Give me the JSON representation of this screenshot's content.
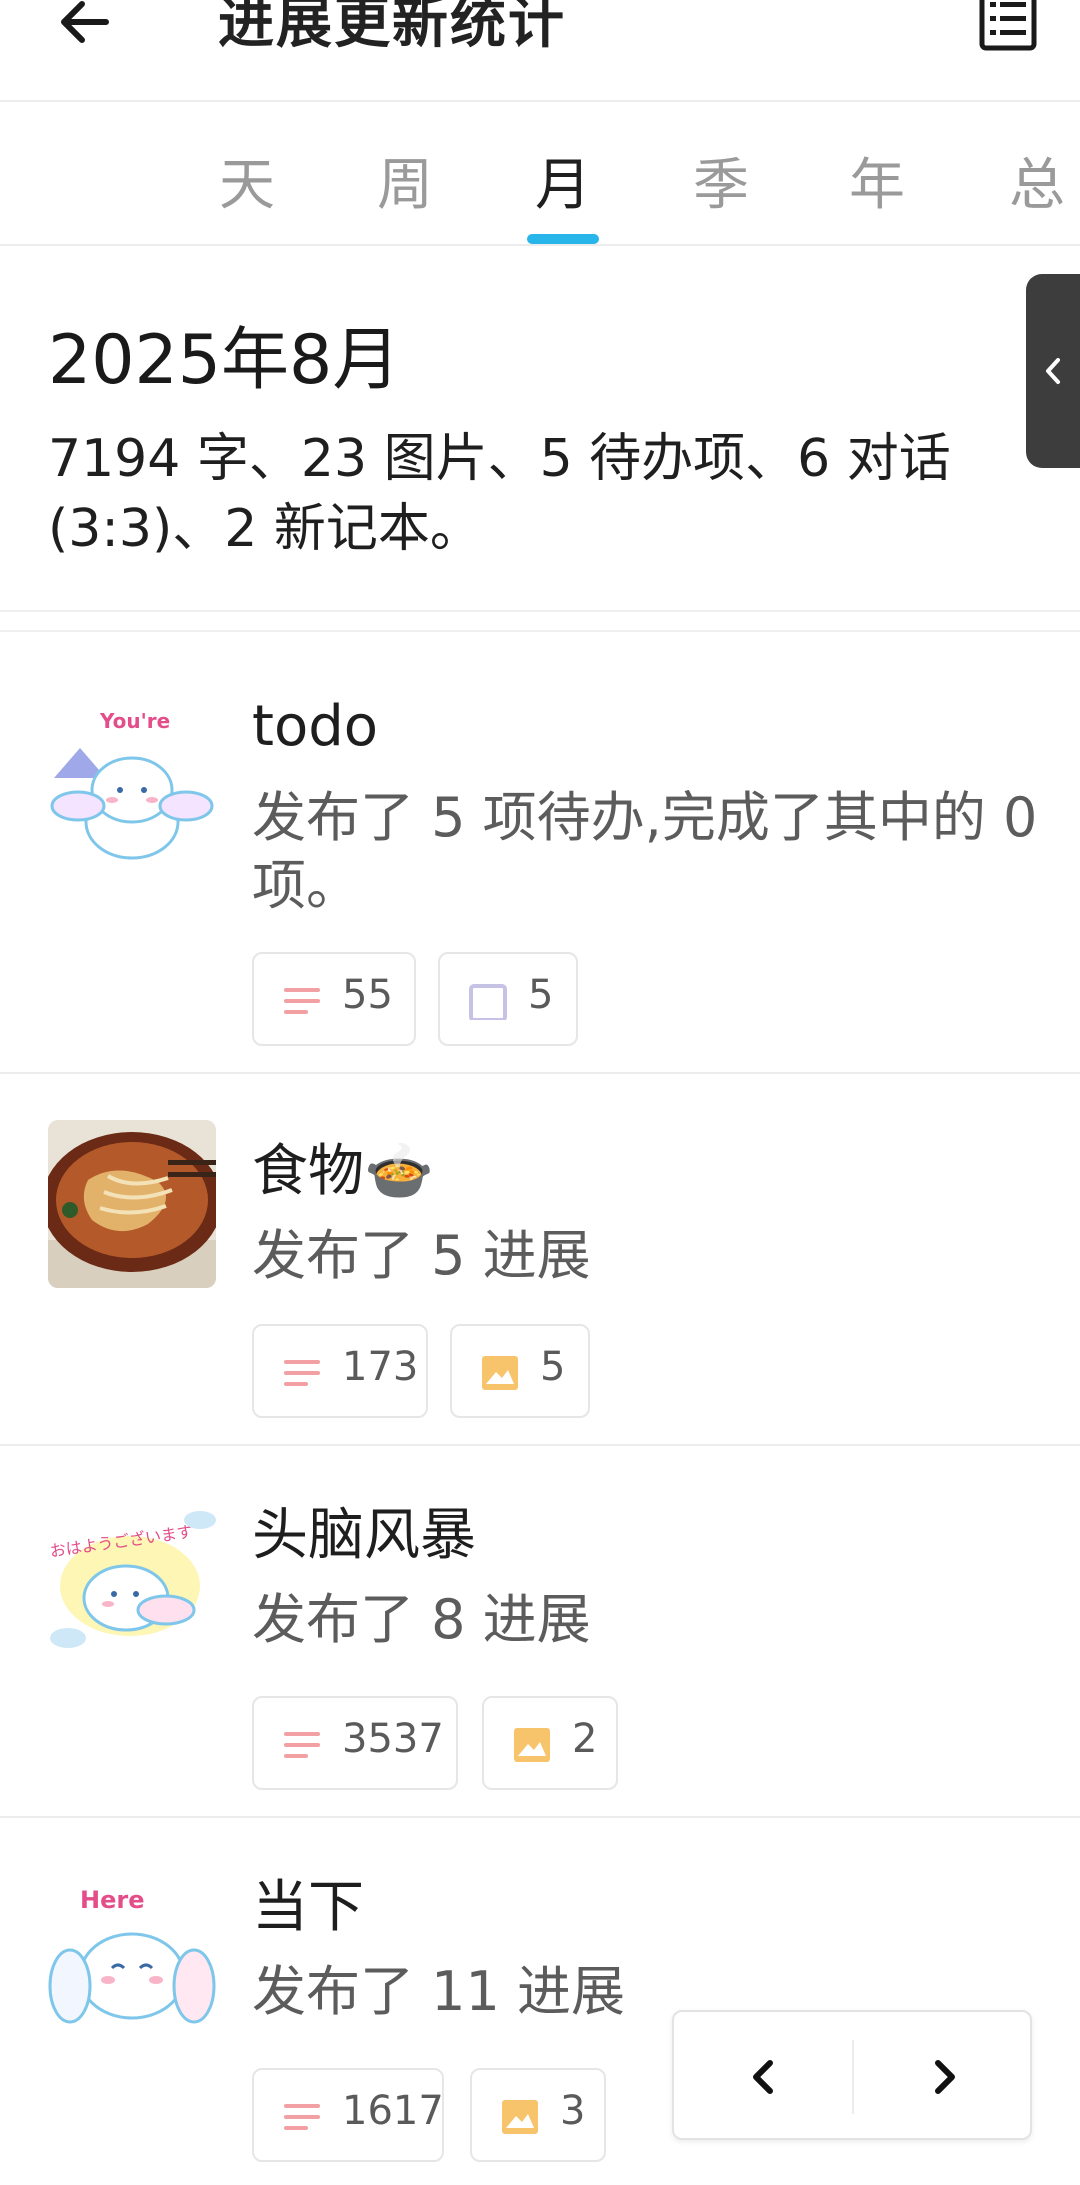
{
  "header": {
    "title": "进展更新统计",
    "back_icon": "arrow-left-icon",
    "list_icon": "list-icon"
  },
  "tabs": [
    {
      "label": "天"
    },
    {
      "label": "周"
    },
    {
      "label": "月"
    },
    {
      "label": "季"
    },
    {
      "label": "年"
    },
    {
      "label": "总"
    }
  ],
  "active_tab": "月",
  "summary": {
    "date": "2025年8月",
    "text": "7194 字、23 图片、5 待办项、6 对话 (3:3)、2 新记本。"
  },
  "notebooks": [
    {
      "name": "todo",
      "desc": "发布了 5 项待办,完成了其中的 0 项。",
      "stats": [
        {
          "icon": "text-lines-icon",
          "value": "55"
        },
        {
          "icon": "checkbox-icon",
          "value": "5"
        }
      ]
    },
    {
      "name": "食物🍲",
      "desc": "发布了 5 进展",
      "stats": [
        {
          "icon": "text-lines-icon",
          "value": "173"
        },
        {
          "icon": "image-icon",
          "value": "5"
        }
      ]
    },
    {
      "name": "头脑风暴",
      "desc": "发布了 8 进展",
      "stats": [
        {
          "icon": "text-lines-icon",
          "value": "3537"
        },
        {
          "icon": "image-icon",
          "value": "2"
        }
      ]
    },
    {
      "name": "当下",
      "desc": "发布了 11 进展",
      "stats": [
        {
          "icon": "text-lines-icon",
          "value": "1617"
        },
        {
          "icon": "image-icon",
          "value": "3"
        }
      ]
    }
  ],
  "thumb_text": {
    "n0": "You're",
    "n2": "おはようございます",
    "n3": "Here"
  },
  "colors": {
    "accent": "#28b6ea",
    "text_icon": "#f2a0a4",
    "checkbox_icon": "#c5c2e6",
    "image_icon": "#f7c46c"
  }
}
